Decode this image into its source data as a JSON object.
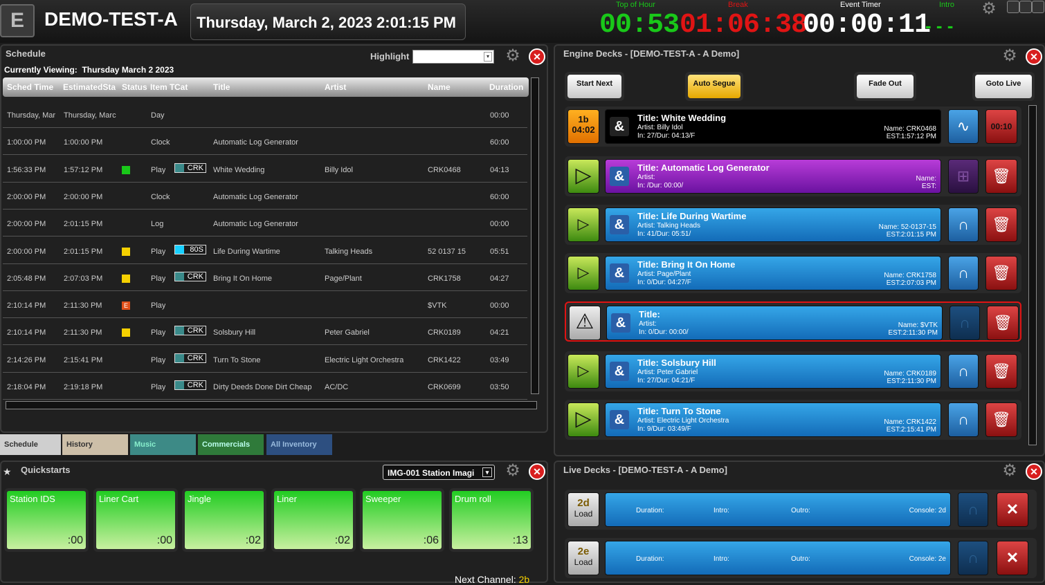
{
  "header": {
    "logo": "E",
    "station": "DEMO-TEST-A",
    "datetime": "Thursday, March 2, 2023 2:01:15 PM",
    "top_of_hour_label": "Top of Hour",
    "top_of_hour": "00:53",
    "break_label": "Break",
    "break": "01:06:38",
    "event_timer_label": "Event Timer",
    "event_timer": "00:00:11",
    "intro_label": "Intro",
    "intro": "- - -"
  },
  "schedule": {
    "title": "Schedule",
    "highlight_label": "Highlight",
    "viewing_label": "Currently Viewing:",
    "viewing_date": "Thursday March 2 2023",
    "columns": [
      "Sched Time",
      "EstimatedSta",
      "Status",
      "Item T",
      "Cat",
      "Title",
      "Artist",
      "Name",
      "Duration"
    ],
    "rows": [
      {
        "sched": "Thursday, Mar",
        "est": "Thursday, Marc",
        "status": "",
        "item": "Day",
        "cat": "",
        "title": "",
        "artist": "",
        "name": "",
        "dur": "00:00"
      },
      {
        "sched": "1:00:00 PM",
        "est": "1:00:00 PM",
        "status": "",
        "item": "Clock",
        "cat": "",
        "title": "Automatic Log Generator",
        "artist": "",
        "name": "",
        "dur": "60:00"
      },
      {
        "sched": "1:56:33 PM",
        "est": "1:57:12 PM",
        "status": "green",
        "item": "Play",
        "cat": "CRK",
        "title": "White Wedding",
        "artist": "Billy Idol",
        "name": "CRK0468",
        "dur": "04:13"
      },
      {
        "sched": "2:00:00 PM",
        "est": "2:00:00 PM",
        "status": "",
        "item": "Clock",
        "cat": "",
        "title": "Automatic Log Generator",
        "artist": "",
        "name": "",
        "dur": "60:00"
      },
      {
        "sched": "2:00:00 PM",
        "est": "2:01:15 PM",
        "status": "",
        "item": "Log",
        "cat": "",
        "title": "Automatic Log Generator",
        "artist": "",
        "name": "",
        "dur": "00:00"
      },
      {
        "sched": "2:00:00 PM",
        "est": "2:01:15 PM",
        "status": "yellow",
        "item": "Play",
        "cat": "80S",
        "title": "Life During Wartime",
        "artist": "Talking Heads",
        "name": "52 0137 15",
        "dur": "05:51"
      },
      {
        "sched": "2:05:48 PM",
        "est": "2:07:03 PM",
        "status": "yellow",
        "item": "Play",
        "cat": "CRK",
        "title": "Bring It On Home",
        "artist": "Page/Plant",
        "name": "CRK1758",
        "dur": "04:27"
      },
      {
        "sched": "2:10:14 PM",
        "est": "2:11:30 PM",
        "status": "E",
        "item": "Play",
        "cat": "",
        "title": "",
        "artist": "",
        "name": "$VTK",
        "dur": "00:00"
      },
      {
        "sched": "2:10:14 PM",
        "est": "2:11:30 PM",
        "status": "yellow",
        "item": "Play",
        "cat": "CRK",
        "title": "Solsbury Hill",
        "artist": "Peter Gabriel",
        "name": "CRK0189",
        "dur": "04:21"
      },
      {
        "sched": "2:14:26 PM",
        "est": "2:15:41 PM",
        "status": "",
        "item": "Play",
        "cat": "CRK",
        "title": "Turn To Stone",
        "artist": "Electric Light Orchestra",
        "name": "CRK1422",
        "dur": "03:49"
      },
      {
        "sched": "2:18:04 PM",
        "est": "2:19:18 PM",
        "status": "",
        "item": "Play",
        "cat": "CRK",
        "title": "Dirty Deeds Done Dirt Cheap",
        "artist": "AC/DC",
        "name": "CRK0699",
        "dur": "03:50"
      }
    ]
  },
  "tabs": [
    "Schedule",
    "History",
    "Music",
    "Commercials",
    "All Inventory"
  ],
  "quickstarts": {
    "title": "Quickstarts",
    "select_value": "IMG-001 Station Imagi",
    "items": [
      {
        "name": "Station IDS",
        "dur": ":00"
      },
      {
        "name": "Liner Cart",
        "dur": ":00"
      },
      {
        "name": "Jingle",
        "dur": ":02"
      },
      {
        "name": "Liner",
        "dur": ":02"
      },
      {
        "name": "Sweeper",
        "dur": ":06"
      },
      {
        "name": "Drum roll",
        "dur": ":13"
      }
    ],
    "next_channel_label": "Next Channel:",
    "next_channel": "2b"
  },
  "engine": {
    "title": "Engine Decks - [DEMO-TEST-A - A Demo]",
    "buttons": [
      "Start Next",
      "Auto Segue",
      "Fade Out",
      "Goto Live"
    ],
    "decks": [
      {
        "left": "1b",
        "left2": "04:02",
        "title": "Title: White Wedding",
        "artist": "Artist: Billy Idol",
        "info": "In: 27/Dur: 04:13/F",
        "name": "Name: CRK0468",
        "est": "EST:1:57:12 PM",
        "right": "00:10"
      },
      {
        "left": "",
        "left2": "",
        "title": "Title: Automatic Log Generator",
        "artist": "Artist:",
        "info": "In: /Dur: 00:00/",
        "name": "Name:",
        "est": "EST:",
        "right": ""
      },
      {
        "left": "",
        "left2": "",
        "title": "Title: Life During Wartime",
        "artist": "Artist: Talking Heads",
        "info": "In: 41/Dur: 05:51/",
        "name": "Name: 52-0137-15",
        "est": "EST:2:01:15 PM",
        "right": ""
      },
      {
        "left": "",
        "left2": "",
        "title": "Title: Bring It On Home",
        "artist": "Artist: Page/Plant",
        "info": "In: 0/Dur: 04:27/F",
        "name": "Name: CRK1758",
        "est": "EST:2:07:03 PM",
        "right": ""
      },
      {
        "left": "",
        "left2": "",
        "title": "Title:",
        "artist": "Artist:",
        "info": "In: 0/Dur: 00:00/",
        "name": "Name: $VTK",
        "est": "EST:2:11:30 PM",
        "right": ""
      },
      {
        "left": "",
        "left2": "",
        "title": "Title: Solsbury Hill",
        "artist": "Artist: Peter Gabriel",
        "info": "In: 27/Dur: 04:21/F",
        "name": "Name: CRK0189",
        "est": "EST:2:11:30 PM",
        "right": ""
      },
      {
        "left": "",
        "left2": "",
        "title": "Title: Turn To Stone",
        "artist": "Artist: Electric Light Orchestra",
        "info": "In: 9/Dur: 03:49/F",
        "name": "Name: CRK1422",
        "est": "EST:2:15:41 PM",
        "right": ""
      }
    ]
  },
  "live": {
    "title": "Live Decks - [DEMO-TEST-A - A Demo]",
    "decks": [
      {
        "id": "2d",
        "load": "Load",
        "duration": "Duration:",
        "intro": "Intro:",
        "outro": "Outro:",
        "console": "Console: 2d"
      },
      {
        "id": "2e",
        "load": "Load",
        "duration": "Duration:",
        "intro": "Intro:",
        "outro": "Outro:",
        "console": "Console: 2e"
      }
    ]
  },
  "colors": {
    "green": "#19c819",
    "red": "#e01414",
    "yellow": "#f5d000",
    "accent_blue": "#1f7fd0"
  }
}
